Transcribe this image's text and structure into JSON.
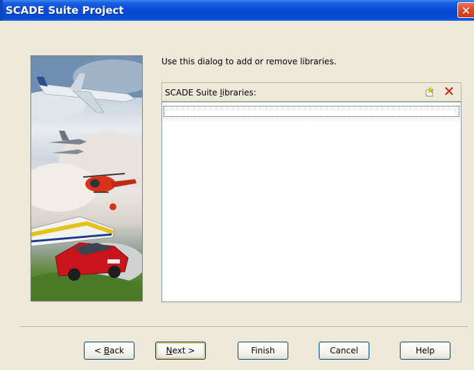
{
  "window": {
    "title": "SCADE Suite Project",
    "close_glyph": "✕"
  },
  "intro_text": "Use this dialog to add or remove libraries.",
  "libraries": {
    "header_prefix": "SCADE Suite ",
    "header_mnemonic": "l",
    "header_suffix": "ibraries:",
    "new_icon": "new-library-icon",
    "delete_icon": "delete-library-icon",
    "delete_glyph": "✕",
    "items": []
  },
  "buttons": {
    "back_pre": "< ",
    "back_mnemonic": "B",
    "back_post": "ack",
    "next_mnemonic": "N",
    "next_post": "ext >",
    "finish": "Finish",
    "cancel": "Cancel",
    "help": "Help"
  },
  "colors": {
    "titlebar": "#0548d0",
    "dialog_bg": "#ece9d8",
    "default_button_ring": "#f5c86a"
  }
}
